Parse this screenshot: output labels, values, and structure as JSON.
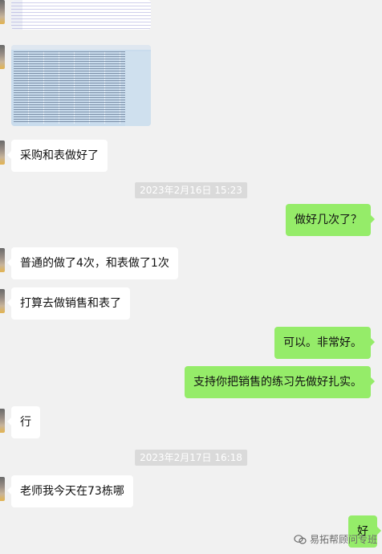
{
  "messages": [
    {
      "text": "采购和表做好了"
    },
    {
      "text": "做好几次了？"
    },
    {
      "text": "普通的做了4次，和表做了1次"
    },
    {
      "text": "打算去做销售和表了"
    },
    {
      "text": "可以。非常好。"
    },
    {
      "text": "支持你把销售的练习先做好扎实。"
    },
    {
      "text": "行"
    },
    {
      "text": "老师我今天在73栋哪"
    },
    {
      "text": "好"
    }
  ],
  "timestamps": [
    "2023年2月16日 15:23",
    "2023年2月17日 16:18"
  ],
  "watermark": {
    "text": "易拓帮顾问专班",
    "icon": "wechat-channel-icon"
  }
}
